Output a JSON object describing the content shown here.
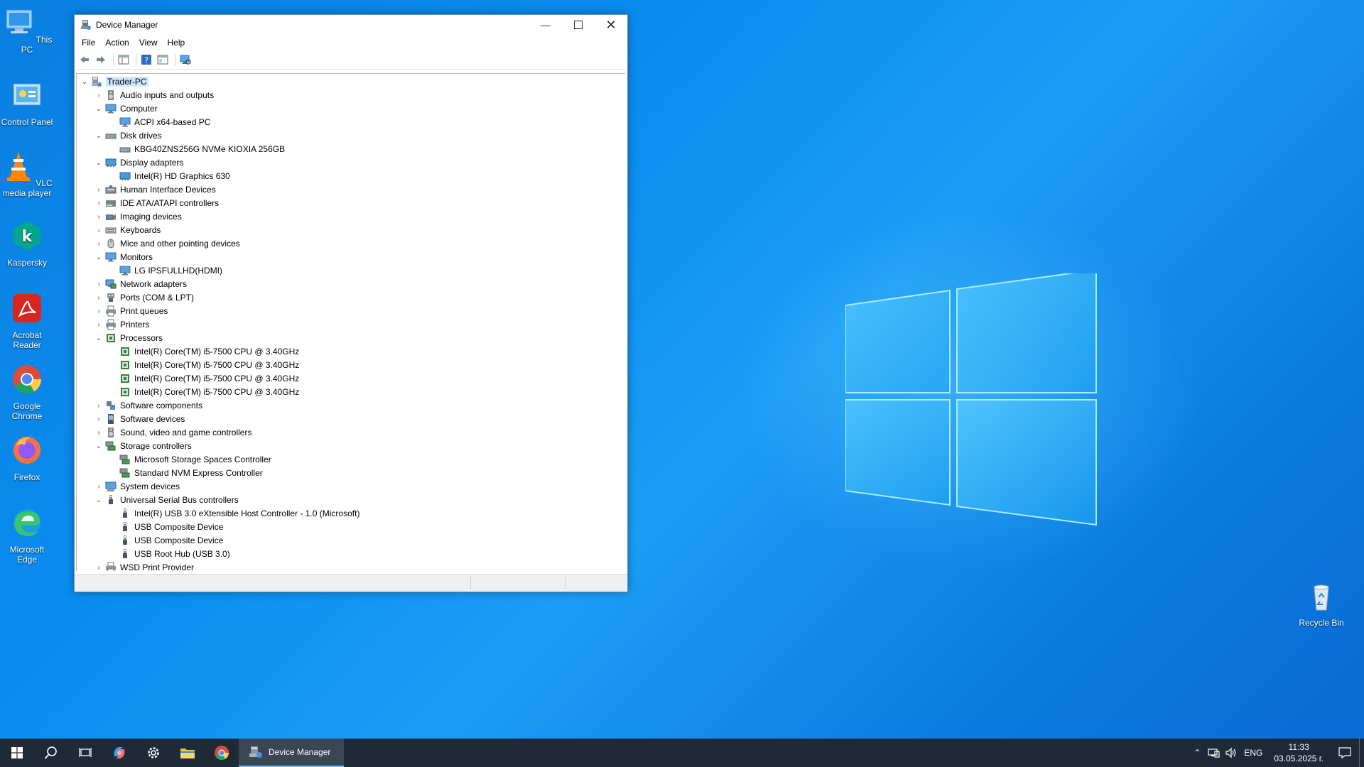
{
  "desktop": {
    "icons": [
      {
        "label": "This PC",
        "icon": "this-pc-icon"
      },
      {
        "label": "Control Panel",
        "icon": "control-panel-icon"
      },
      {
        "label": "VLC media player",
        "icon": "vlc-icon"
      },
      {
        "label": "Kaspersky",
        "icon": "kaspersky-icon"
      },
      {
        "label": "Acrobat Reader",
        "icon": "acrobat-icon"
      },
      {
        "label": "Google Chrome",
        "icon": "chrome-icon"
      },
      {
        "label": "Firefox",
        "icon": "firefox-icon"
      },
      {
        "label": "Microsoft Edge",
        "icon": "edge-icon"
      }
    ],
    "recycle_bin": "Recycle Bin"
  },
  "window": {
    "title": "Device Manager",
    "menu": [
      "File",
      "Action",
      "View",
      "Help"
    ]
  },
  "tree": [
    {
      "label": "Trader-PC",
      "level": 0,
      "state": "expanded",
      "icon": "computer-icon",
      "selected": true
    },
    {
      "label": "Audio inputs and outputs",
      "level": 1,
      "state": "collapsed",
      "icon": "speaker-icon"
    },
    {
      "label": "Computer",
      "level": 1,
      "state": "expanded",
      "icon": "monitor-icon"
    },
    {
      "label": "ACPI x64-based PC",
      "level": 2,
      "state": "none",
      "icon": "monitor-icon"
    },
    {
      "label": "Disk drives",
      "level": 1,
      "state": "expanded",
      "icon": "disk-icon"
    },
    {
      "label": "KBG40ZNS256G NVMe KIOXIA 256GB",
      "level": 2,
      "state": "none",
      "icon": "disk-icon"
    },
    {
      "label": "Display adapters",
      "level": 1,
      "state": "expanded",
      "icon": "display-adapter-icon"
    },
    {
      "label": "Intel(R) HD Graphics 630",
      "level": 2,
      "state": "none",
      "icon": "display-adapter-icon"
    },
    {
      "label": "Human Interface Devices",
      "level": 1,
      "state": "collapsed",
      "icon": "hid-icon"
    },
    {
      "label": "IDE ATA/ATAPI controllers",
      "level": 1,
      "state": "collapsed",
      "icon": "ide-icon"
    },
    {
      "label": "Imaging devices",
      "level": 1,
      "state": "collapsed",
      "icon": "camera-icon"
    },
    {
      "label": "Keyboards",
      "level": 1,
      "state": "collapsed",
      "icon": "keyboard-icon"
    },
    {
      "label": "Mice and other pointing devices",
      "level": 1,
      "state": "collapsed",
      "icon": "mouse-icon"
    },
    {
      "label": "Monitors",
      "level": 1,
      "state": "expanded",
      "icon": "monitor-icon"
    },
    {
      "label": "LG IPSFULLHD(HDMI)",
      "level": 2,
      "state": "none",
      "icon": "monitor-icon"
    },
    {
      "label": "Network adapters",
      "level": 1,
      "state": "collapsed",
      "icon": "network-icon"
    },
    {
      "label": "Ports (COM & LPT)",
      "level": 1,
      "state": "collapsed",
      "icon": "port-icon"
    },
    {
      "label": "Print queues",
      "level": 1,
      "state": "collapsed",
      "icon": "printer-icon"
    },
    {
      "label": "Printers",
      "level": 1,
      "state": "collapsed",
      "icon": "printer-icon"
    },
    {
      "label": "Processors",
      "level": 1,
      "state": "expanded",
      "icon": "cpu-icon"
    },
    {
      "label": "Intel(R) Core(TM) i5-7500 CPU @ 3.40GHz",
      "level": 2,
      "state": "none",
      "icon": "cpu-icon"
    },
    {
      "label": "Intel(R) Core(TM) i5-7500 CPU @ 3.40GHz",
      "level": 2,
      "state": "none",
      "icon": "cpu-icon"
    },
    {
      "label": "Intel(R) Core(TM) i5-7500 CPU @ 3.40GHz",
      "level": 2,
      "state": "none",
      "icon": "cpu-icon"
    },
    {
      "label": "Intel(R) Core(TM) i5-7500 CPU @ 3.40GHz",
      "level": 2,
      "state": "none",
      "icon": "cpu-icon"
    },
    {
      "label": "Software components",
      "level": 1,
      "state": "collapsed",
      "icon": "software-icon"
    },
    {
      "label": "Software devices",
      "level": 1,
      "state": "collapsed",
      "icon": "software-device-icon"
    },
    {
      "label": "Sound, video and game controllers",
      "level": 1,
      "state": "collapsed",
      "icon": "speaker-icon"
    },
    {
      "label": "Storage controllers",
      "level": 1,
      "state": "expanded",
      "icon": "storage-icon"
    },
    {
      "label": "Microsoft Storage Spaces Controller",
      "level": 2,
      "state": "none",
      "icon": "storage-icon"
    },
    {
      "label": "Standard NVM Express Controller",
      "level": 2,
      "state": "none",
      "icon": "storage-icon"
    },
    {
      "label": "System devices",
      "level": 1,
      "state": "collapsed",
      "icon": "system-icon"
    },
    {
      "label": "Universal Serial Bus controllers",
      "level": 1,
      "state": "expanded",
      "icon": "usb-icon"
    },
    {
      "label": "Intel(R) USB 3.0 eXtensible Host Controller - 1.0 (Microsoft)",
      "level": 2,
      "state": "none",
      "icon": "usb-icon"
    },
    {
      "label": "USB Composite Device",
      "level": 2,
      "state": "none",
      "icon": "usb-icon"
    },
    {
      "label": "USB Composite Device",
      "level": 2,
      "state": "none",
      "icon": "usb-icon"
    },
    {
      "label": "USB Root Hub (USB 3.0)",
      "level": 2,
      "state": "none",
      "icon": "usb-icon"
    },
    {
      "label": "WSD Print Provider",
      "level": 1,
      "state": "collapsed",
      "icon": "printer-icon"
    }
  ],
  "taskbar": {
    "active_app": "Device Manager",
    "tray": {
      "language": "ENG",
      "time": "11:33",
      "date": "03.05.2025 г."
    }
  },
  "colors": {
    "selection": "#cce8ff",
    "taskbar": "#1f2a36",
    "desktop": "#0a8ef0"
  }
}
